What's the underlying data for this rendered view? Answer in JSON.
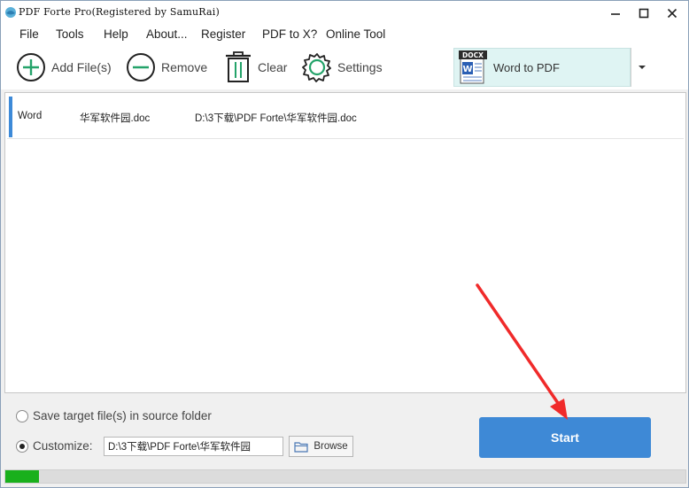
{
  "window": {
    "title": "PDF Forte Pro(Registered by SamuRai)"
  },
  "menu": {
    "items": [
      "File",
      "Tools",
      "Help",
      "About...",
      "Register",
      "PDF to X?",
      "Online Tool"
    ]
  },
  "toolbar": {
    "add_label": "Add File(s)",
    "remove_label": "Remove",
    "clear_label": "Clear",
    "settings_label": "Settings",
    "convert_badge": "DOCX",
    "convert_label": "Word to PDF",
    "accent_color": "#24a36a"
  },
  "file_list": {
    "rows": [
      {
        "type": "Word",
        "name": "华军软件园.doc",
        "path": "D:\\3下载\\PDF Forte\\华军软件园.doc"
      }
    ]
  },
  "output": {
    "source_folder_label": "Save target file(s) in source folder",
    "customize_label": "Customize:",
    "customize_path": "D:\\3下载\\PDF Forte\\华军软件园",
    "browse_label": "Browse",
    "selected_option": "customize"
  },
  "start": {
    "label": "Start",
    "color": "#3e89d6"
  },
  "progress": {
    "percent": 5,
    "color": "#19b01c"
  },
  "annotation": {
    "color": "#f02a2a"
  }
}
